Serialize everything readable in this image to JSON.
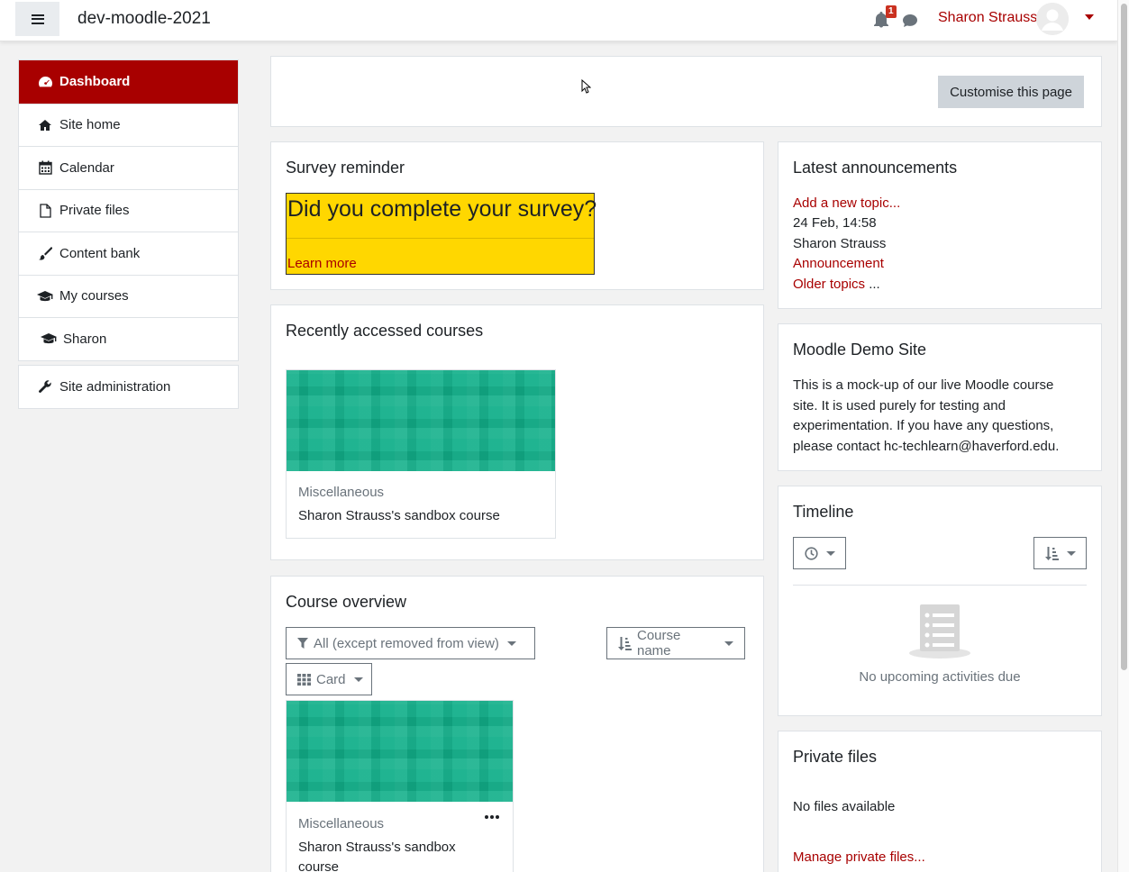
{
  "header": {
    "site_title": "dev-moodle-2021",
    "notification_count": "1",
    "user_name": "Sharon Strauss"
  },
  "sidebar": {
    "items": [
      {
        "label": "Dashboard",
        "icon": "dashboard-icon",
        "active": true
      },
      {
        "label": "Site home",
        "icon": "home-icon"
      },
      {
        "label": "Calendar",
        "icon": "calendar-icon"
      },
      {
        "label": "Private files",
        "icon": "file-icon"
      },
      {
        "label": "Content bank",
        "icon": "paintbrush-icon"
      },
      {
        "label": "My courses",
        "icon": "graduation-cap-icon"
      },
      {
        "label": "Sharon",
        "icon": "graduation-cap-icon"
      }
    ],
    "admin": {
      "label": "Site administration",
      "icon": "wrench-icon"
    }
  },
  "customise": {
    "button_label": "Customise this page"
  },
  "survey": {
    "title": "Survey reminder",
    "question": "Did you complete your survey?",
    "link": "Learn more",
    "background": "#ffd700"
  },
  "recent": {
    "title": "Recently accessed courses",
    "course": {
      "category": "Miscellaneous",
      "name": "Sharon Strauss's sandbox course"
    }
  },
  "overview": {
    "title": "Course overview",
    "filter_label": "All (except removed from view)",
    "sort_label": "Course name",
    "view_label": "Card",
    "course": {
      "category": "Miscellaneous",
      "name_line1": "Sharon Strauss's sandbox",
      "name_line2": "course"
    }
  },
  "announcements": {
    "title": "Latest announcements",
    "add_topic": "Add a new topic...",
    "date": "24 Feb, 14:58",
    "author": "Sharon Strauss",
    "post": "Announcement",
    "older": "Older topics",
    "older_suffix": " ..."
  },
  "demo": {
    "title": "Moodle Demo Site",
    "text": "This is a mock-up of our live Moodle course site. It is used purely for testing and experimentation. If you have any questions, please contact hc-techlearn@haverford.edu."
  },
  "timeline": {
    "title": "Timeline",
    "empty": "No upcoming activities due"
  },
  "private_files": {
    "title": "Private files",
    "empty": "No files available",
    "manage": "Manage private files..."
  },
  "colors": {
    "brand": "#a80000",
    "course_image": "#12b08a"
  }
}
